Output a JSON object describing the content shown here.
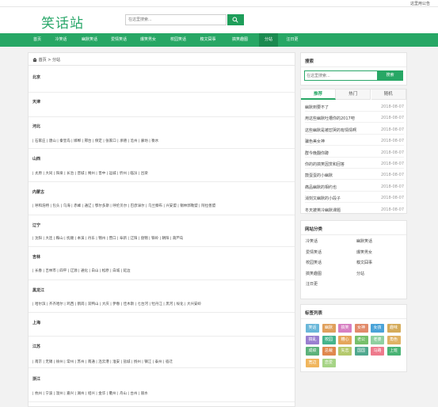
{
  "topbar": {
    "notice": "这里用公告"
  },
  "header": {
    "logo": "笑话站",
    "search_placeholder": "在这里搜索..."
  },
  "nav": [
    {
      "label": "首页",
      "x": 0
    },
    {
      "label": "冷笑话",
      "x": 0
    },
    {
      "label": "幽默笑话",
      "x": 0
    },
    {
      "label": "爱情笑话",
      "x": 0
    },
    {
      "label": "爆笑男女",
      "x": 0
    },
    {
      "label": "校园笑话",
      "x": 0
    },
    {
      "label": "糗文囧事",
      "x": 0
    },
    {
      "label": "搞笑趣图",
      "x": 0
    },
    {
      "label": "分站",
      "x": 0
    },
    {
      "label": "汪日更",
      "x": 0
    }
  ],
  "breadcrumb": {
    "home": "首页",
    "sep": " > ",
    "current": "分站"
  },
  "provinces": [
    {
      "name": "北京",
      "cities": ""
    },
    {
      "name": "天津",
      "cities": ""
    },
    {
      "name": "河北",
      "cities": "| 石家庄 | 唐山 | 秦皇岛 | 邯郸 | 邢台 | 保定 | 张家口 | 承德 | 沧州 | 廊坊 | 衡水"
    },
    {
      "name": "山西",
      "cities": "| 太原 | 大同 | 阳泉 | 长治 | 晋城 | 朔州 | 晋中 | 运城 | 忻州 | 临汾 | 吕梁"
    },
    {
      "name": "内蒙古",
      "cities": "| 呼和浩特 | 包头 | 乌海 | 赤峰 | 通辽 | 鄂尔多斯 | 呼伦贝尔 | 巴彦淖尔 | 乌兰察布 | 兴安盟 | 锡林郭勒盟 | 阿拉善盟"
    },
    {
      "name": "辽宁",
      "cities": "| 沈阳 | 大连 | 鞍山 | 抚顺 | 本溪 | 丹东 | 锦州 | 营口 | 阜新 | 辽阳 | 盘锦 | 铁岭 | 朝阳 | 葫芦岛"
    },
    {
      "name": "吉林",
      "cities": "| 长春 | 吉林市 | 四平 | 辽源 | 通化 | 白山 | 松原 | 白城 | 延边"
    },
    {
      "name": "黑龙江",
      "cities": "| 哈尔滨 | 齐齐哈尔 | 鸡西 | 鹤岗 | 双鸭山 | 大庆 | 伊春 | 佳木斯 | 七台河 | 牡丹江 | 黑河 | 绥化 | 大兴安岭"
    },
    {
      "name": "上海",
      "cities": ""
    },
    {
      "name": "江苏",
      "cities": "| 南京 | 无锡 | 徐州 | 常州 | 苏州 | 南通 | 连云港 | 淮安 | 盐城 | 扬州 | 镇江 | 泰州 | 宿迁"
    },
    {
      "name": "浙江",
      "cities": "| 杭州 | 宁波 | 温州 | 嘉兴 | 湖州 | 绍兴 | 金华 | 衢州 | 舟山 | 台州 | 丽水"
    }
  ],
  "sidebar": {
    "search": {
      "title": "搜索",
      "placeholder": "在这里搜索...",
      "button": "搜索"
    },
    "tabs": [
      "推荐",
      "热门",
      "随机"
    ],
    "articles": [
      {
        "title": "幽默到要不了",
        "date": "2018-08-07"
      },
      {
        "title": "用这些幽默吐槽你的2017吧",
        "date": "2018-08-07"
      },
      {
        "title": "这些幽默是被怼哭的有情情啊",
        "date": "2018-08-07"
      },
      {
        "title": "骗色美女神",
        "date": "2018-08-07"
      },
      {
        "title": "群今晚翻你蹲",
        "date": "2018-08-07"
      },
      {
        "title": "你的的搞笑因赏和回答",
        "date": "2018-08-07"
      },
      {
        "title": "鼓蛋蛋的小幽默",
        "date": "2018-08-07"
      },
      {
        "title": "痛品幽默的相约也",
        "date": "2018-08-07"
      },
      {
        "title": "消刻又幽默的小段子",
        "date": "2018-08-07"
      },
      {
        "title": "冬天披英冷幽默课题",
        "date": "2018-08-07"
      }
    ],
    "categories_title": "网站分类",
    "categories": [
      "冷笑话",
      "幽默笑话",
      "爱情笑话",
      "爆笑男女",
      "校园笑话",
      "糗文囧事",
      "搞笑趣图",
      "分站",
      "汪日更"
    ],
    "tags_title": "标签列表",
    "tags": [
      {
        "label": "笑话",
        "color": "#6ab7d9"
      },
      {
        "label": "幽默",
        "color": "#e0a05c"
      },
      {
        "label": "搞笑",
        "color": "#d77fc2"
      },
      {
        "label": "女神",
        "color": "#e28a6a"
      },
      {
        "label": "女孩",
        "color": "#4aa3d8"
      },
      {
        "label": "趣味",
        "color": "#d5ab5a"
      },
      {
        "label": "搞乱",
        "color": "#9a7fd0"
      },
      {
        "label": "校园",
        "color": "#45b48c"
      },
      {
        "label": "糟心",
        "color": "#e5a65b"
      },
      {
        "label": "老公",
        "color": "#77c06b"
      },
      {
        "label": "老婆",
        "color": "#8fd0a0"
      },
      {
        "label": "角色",
        "color": "#e0b264"
      },
      {
        "label": "成绩",
        "color": "#5cb27a"
      },
      {
        "label": "总裁",
        "color": "#e0884e"
      },
      {
        "label": "矢志",
        "color": "#b4c96c"
      },
      {
        "label": "国国",
        "color": "#4fa88e"
      },
      {
        "label": "马路",
        "color": "#ee7a8c"
      },
      {
        "label": "上班",
        "color": "#49b374"
      },
      {
        "label": "宽边",
        "color": "#f0b55c"
      },
      {
        "label": "恋爱",
        "color": "#a6d486"
      }
    ]
  }
}
